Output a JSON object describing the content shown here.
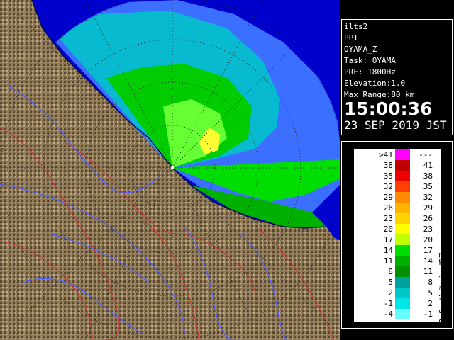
{
  "info": {
    "site": "ilts2",
    "scan_type": "PPI",
    "product": "OYAMA_Z",
    "task": "Task: OYAMA",
    "prf": "PRF: 1800Hz",
    "elevation": "Elevation:1.0",
    "max_range": "Max Range:80 km",
    "time": "15:00:36",
    "date": "23 SEP 2019 JST"
  },
  "legend": {
    "unit_label": "Reflectivity in dBZ",
    "rows": [
      {
        "low": ">41",
        "high": "---",
        "color": "#ff00ff"
      },
      {
        "low": "38",
        "high": "41",
        "color": "#c00000"
      },
      {
        "low": "35",
        "high": "38",
        "color": "#ee0000"
      },
      {
        "low": "32",
        "high": "35",
        "color": "#ff4000"
      },
      {
        "low": "29",
        "high": "32",
        "color": "#ff8c00"
      },
      {
        "low": "26",
        "high": "29",
        "color": "#ffb400"
      },
      {
        "low": "23",
        "high": "26",
        "color": "#ffd400"
      },
      {
        "low": "20",
        "high": "23",
        "color": "#ffff00"
      },
      {
        "low": "17",
        "high": "20",
        "color": "#c0ff00"
      },
      {
        "low": "14",
        "high": "17",
        "color": "#00dd00"
      },
      {
        "low": "11",
        "high": "14",
        "color": "#00b000"
      },
      {
        "low": "8",
        "high": "11",
        "color": "#009000"
      },
      {
        "low": "5",
        "high": "8",
        "color": "#00a0a0"
      },
      {
        "low": "2",
        "high": "5",
        "color": "#00c8c8"
      },
      {
        "low": "-1",
        "high": "2",
        "color": "#00e6e6"
      },
      {
        "low": "-4",
        "high": "-1",
        "color": "#66ffff"
      }
    ]
  },
  "colors": {
    "background": "#000000",
    "sea": "#0000cc",
    "land": "#8c7a5a",
    "echo_blue": "#3c78ff",
    "echo_green": "#00dd00",
    "rivers": "#4f5fff",
    "boundaries": "#d03030"
  }
}
